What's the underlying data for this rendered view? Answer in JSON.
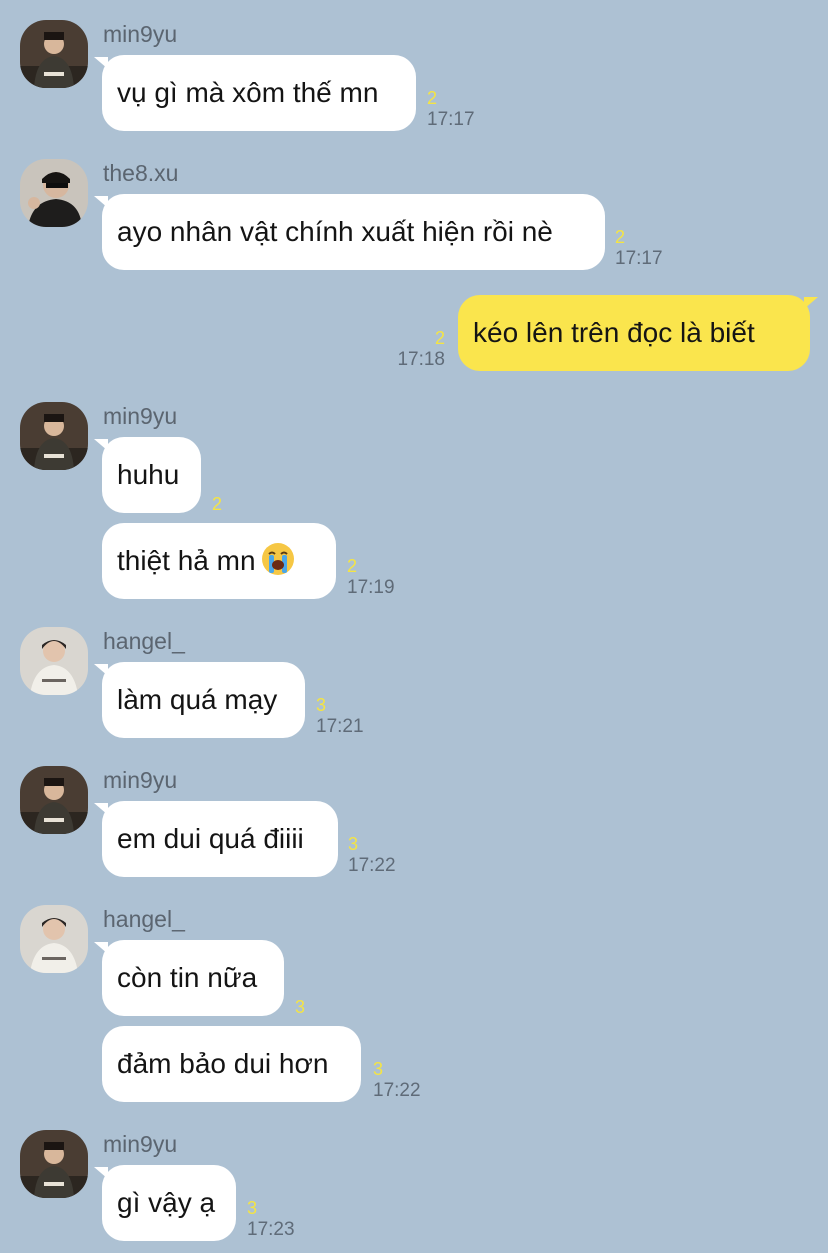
{
  "colors": {
    "background": "#adc1d3",
    "incoming_bubble": "#ffffff",
    "outgoing_bubble": "#fae54d",
    "unread_count": "#f4e444",
    "time_text": "#5f6b78"
  },
  "messages": [
    {
      "sender": "min9yu",
      "avatar": "avatar-min9yu-icon",
      "text": "vụ gì mà xôm thế mn",
      "unread": "2",
      "time": "17:17"
    },
    {
      "sender": "the8.xu",
      "avatar": "avatar-the8xu-icon",
      "text": "ayo nhân vật chính xuất hiện rồi nè",
      "unread": "2",
      "time": "17:17"
    },
    {
      "sender": "",
      "outgoing": true,
      "text": "kéo lên trên đọc là biết",
      "unread": "2",
      "time": "17:18"
    },
    {
      "sender": "min9yu",
      "avatar": "avatar-min9yu-icon",
      "text": "huhu",
      "unread": "2",
      "time": ""
    },
    {
      "sender": "",
      "text": "thiệt hả mn",
      "emoji": "loudly-crying-face-icon",
      "unread": "2",
      "time": "17:19"
    },
    {
      "sender": "hangel_",
      "avatar": "avatar-hangel-icon",
      "text": "làm quá mạy",
      "unread": "3",
      "time": "17:21"
    },
    {
      "sender": "min9yu",
      "avatar": "avatar-min9yu-icon",
      "text": "em dui quá điiii",
      "unread": "3",
      "time": "17:22"
    },
    {
      "sender": "hangel_",
      "avatar": "avatar-hangel-icon",
      "text": "còn tin nữa",
      "unread": "3",
      "time": ""
    },
    {
      "sender": "",
      "text": "đảm bảo dui hơn",
      "unread": "3",
      "time": "17:22"
    },
    {
      "sender": "min9yu",
      "avatar": "avatar-min9yu-icon",
      "text": "gì vậy ạ",
      "unread": "3",
      "time": "17:23"
    }
  ]
}
